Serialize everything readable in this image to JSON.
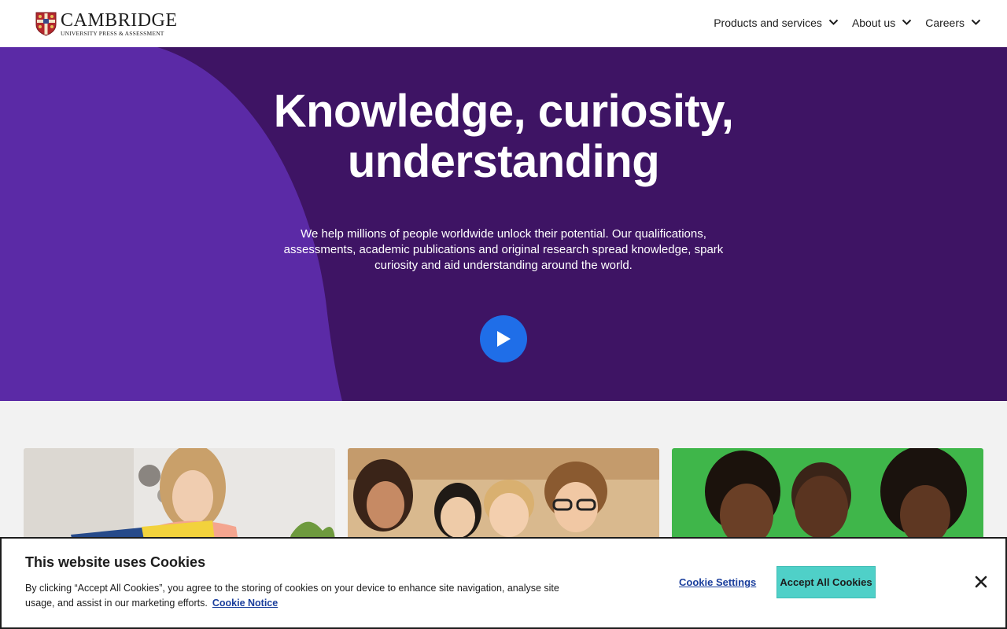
{
  "header": {
    "logo": {
      "main": "CAMBRIDGE",
      "sub": "UNIVERSITY PRESS & ASSESSMENT",
      "icon": "cambridge-crest-icon"
    },
    "nav": [
      {
        "label": "Products and services",
        "icon": "chevron-down-icon"
      },
      {
        "label": "About us",
        "icon": "chevron-down-icon"
      },
      {
        "label": "Careers",
        "icon": "chevron-down-icon"
      }
    ]
  },
  "hero": {
    "title_line1": "Knowledge, curiosity,",
    "title_line2": "understanding",
    "description": "We help millions of people worldwide unlock their potential. Our qualifications, assessments, academic publications and original research spread knowledge, spark curiosity and aid understanding around the world.",
    "play_icon": "play-icon",
    "colors": {
      "background": "#3e1464",
      "blob": "#5b2aa6",
      "play": "#1f6ee8"
    }
  },
  "cards": [
    {
      "image": "woman-reading-photo"
    },
    {
      "image": "students-group-photo"
    },
    {
      "image": "children-green-background-photo"
    }
  ],
  "cookie_banner": {
    "title": "This website uses Cookies",
    "text": "By clicking “Accept All Cookies”, you agree to the storing of cookies on your device to enhance site navigation, analyse site usage, and assist in our marketing efforts.",
    "notice_link": "Cookie Notice",
    "settings_label": "Cookie Settings",
    "accept_label": "Accept All Cookies",
    "close_icon": "close-icon",
    "colors": {
      "accept": "#4fd0c8",
      "link": "#1a3e9c"
    }
  }
}
